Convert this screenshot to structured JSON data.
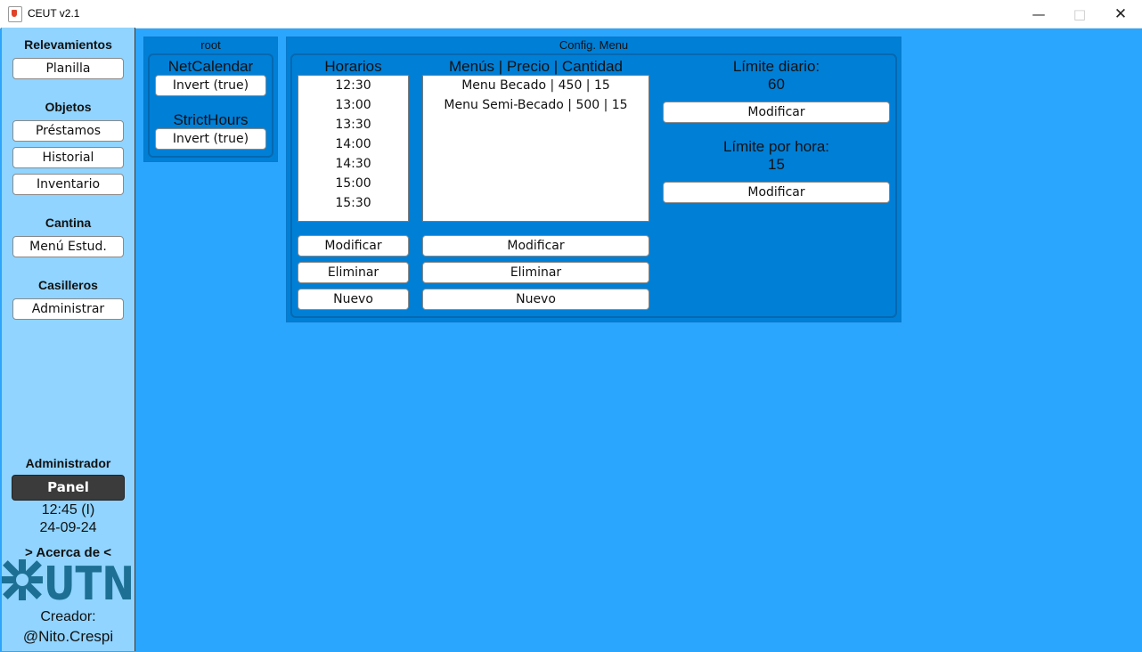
{
  "window": {
    "title": "CEUT v2.1",
    "minimize": "—",
    "maximize": "□",
    "close": "✕"
  },
  "sidebar": {
    "relevamientos": {
      "heading": "Relevamientos",
      "buttons": [
        "Planilla"
      ]
    },
    "objetos": {
      "heading": "Objetos",
      "buttons": [
        "Préstamos",
        "Historial",
        "Inventario"
      ]
    },
    "cantina": {
      "heading": "Cantina",
      "buttons": [
        "Menú Estud."
      ]
    },
    "casilleros": {
      "heading": "Casilleros",
      "buttons": [
        "Administrar"
      ]
    },
    "admin": {
      "heading": "Administrador",
      "panel": "Panel"
    },
    "time": "12:45 (I)",
    "date": "24-09-24",
    "about": "> Acerca de <",
    "logo_text": "UTN",
    "creator_label": "Creador:",
    "creator_handle": "@Nito.Crespi"
  },
  "root_panel": {
    "title": "root",
    "netcalendar_label": "NetCalendar",
    "netcalendar_button": "Invert (true)",
    "stricthours_label": "StrictHours",
    "stricthours_button": "Invert (true)"
  },
  "config_menu": {
    "title": "Config. Menu",
    "horarios": {
      "heading": "Horarios",
      "items": [
        "12:30",
        "13:00",
        "13:30",
        "14:00",
        "14:30",
        "15:00",
        "15:30"
      ],
      "buttons": [
        "Modificar",
        "Eliminar",
        "Nuevo"
      ]
    },
    "menus": {
      "heading": "Menús | Precio | Cantidad",
      "items": [
        "Menu Becado | 450 | 15",
        "Menu Semi-Becado | 500 | 15"
      ],
      "buttons": [
        "Modificar",
        "Eliminar",
        "Nuevo"
      ]
    },
    "limite_diario": {
      "label": "Límite diario:",
      "value": "60",
      "button": "Modificar"
    },
    "limite_hora": {
      "label": "Límite por hora:",
      "value": "15",
      "button": "Modificar"
    }
  },
  "colors": {
    "background": "#2ba6ff",
    "sidebar": "#90d4ff",
    "panel": "#007fd6",
    "panel_button": "#3b3b3b",
    "logo": "#1d6f93"
  }
}
